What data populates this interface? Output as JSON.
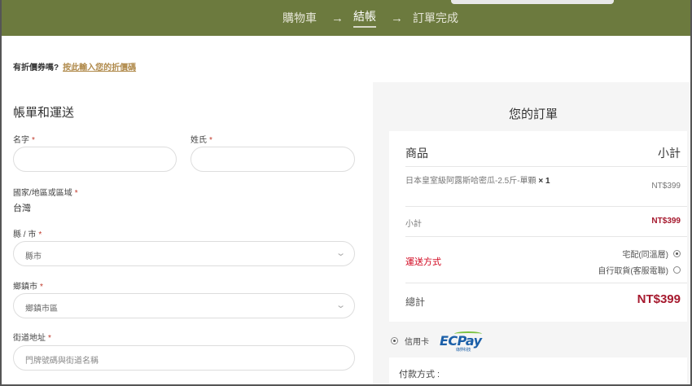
{
  "steps": {
    "cart": "購物車",
    "arrow1": "→",
    "checkout": "結帳",
    "arrow2": "→",
    "complete": "訂單完成"
  },
  "coupon": {
    "question": "有折價券嗎?",
    "link": "按此輸入您的折價碼"
  },
  "billing": {
    "title": "帳單和運送",
    "first_name_label": "名字",
    "last_name_label": "姓氏",
    "country_label": "國家/地區或區域",
    "country_value": "台灣",
    "county_label": "縣 / 市",
    "county_value": "縣市",
    "town_label": "鄉鎮市",
    "town_value": "鄉鎮市區",
    "street_label": "街道地址",
    "street_placeholder": "門牌號碼與街道名稱",
    "required_mark": "*"
  },
  "order": {
    "title": "您的訂單",
    "col_product": "商品",
    "col_subtotal": "小計",
    "product_name": "日本皇室級阿露斯哈密瓜-2.5斤-單顆",
    "product_qty": "× 1",
    "product_price": "NT$399",
    "subtotal_label": "小計",
    "subtotal_value": "NT$399",
    "shipping_label": "運送方式",
    "shipping_options": [
      {
        "label": "宅配(同溫層)",
        "selected": true
      },
      {
        "label": "自行取貨(客服電聯)",
        "selected": false
      }
    ],
    "total_label": "總計",
    "total_value": "NT$399"
  },
  "payment": {
    "method_label": "信用卡",
    "logo_text_ec": "EC",
    "logo_text_pay": "Pay",
    "logo_subtext": "綠界科技",
    "box_label": "付款方式 :"
  },
  "colors": {
    "header_bg": "#6c7a3e",
    "accent_link": "#b08a4b",
    "price_red": "#a6192e",
    "shipping_red": "#d0021b"
  }
}
